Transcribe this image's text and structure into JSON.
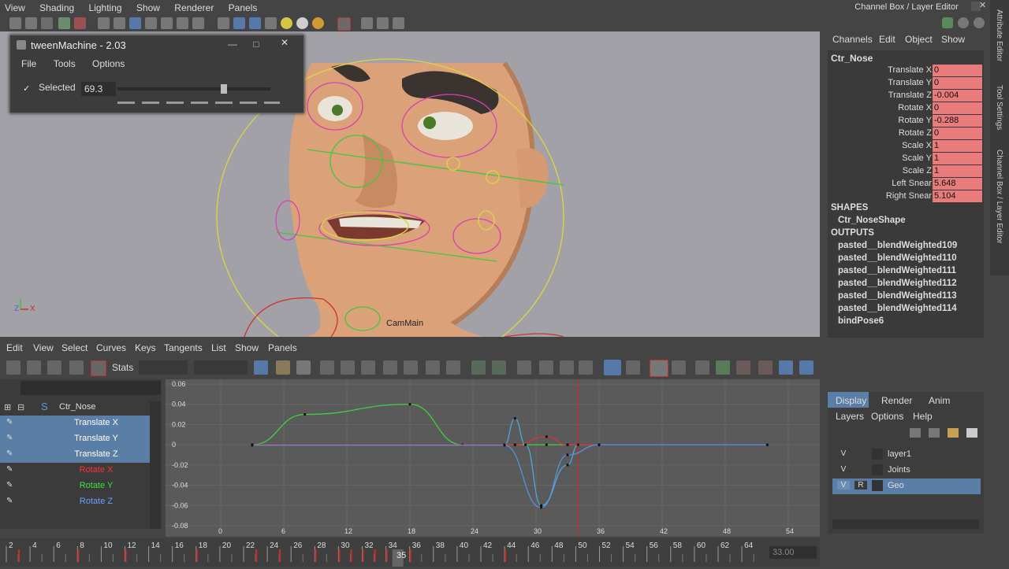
{
  "menubar": [
    "View",
    "Shading",
    "Lighting",
    "Show",
    "Renderer",
    "Panels"
  ],
  "viewport": {
    "camera_label": "CamMain",
    "axis_x": "X",
    "axis_z": "Z"
  },
  "tween": {
    "title": "tweenMachine - 2.03",
    "menu": [
      "File",
      "Tools",
      "Options"
    ],
    "selected_label": "Selected",
    "value": "69.3",
    "slider_fraction": 0.69
  },
  "channelbox": {
    "title": "Channel Box / Layer Editor",
    "menu": [
      "Channels",
      "Edit",
      "Object",
      "Show"
    ],
    "node": "Ctr_Nose",
    "channels": [
      {
        "name": "Translate X",
        "value": "0"
      },
      {
        "name": "Translate Y",
        "value": "0"
      },
      {
        "name": "Translate Z",
        "value": "-0.004"
      },
      {
        "name": "Rotate X",
        "value": "0"
      },
      {
        "name": "Rotate Y",
        "value": "-0.288"
      },
      {
        "name": "Rotate Z",
        "value": "0"
      },
      {
        "name": "Scale X",
        "value": "1"
      },
      {
        "name": "Scale Y",
        "value": "1"
      },
      {
        "name": "Scale Z",
        "value": "1"
      },
      {
        "name": "Left Snear",
        "value": "5.648"
      },
      {
        "name": "Right Snear",
        "value": "5.104"
      }
    ],
    "shapes_header": "SHAPES",
    "shape": "Ctr_NoseShape",
    "outputs_header": "OUTPUTS",
    "outputs": [
      "pasted__blendWeighted109",
      "pasted__blendWeighted110",
      "pasted__blendWeighted111",
      "pasted__blendWeighted112",
      "pasted__blendWeighted113",
      "pasted__blendWeighted114",
      "bindPose6"
    ]
  },
  "side_tabs": [
    "Attribute Editor",
    "Tool Settings",
    "Channel Box / Layer Editor"
  ],
  "layer_editor": {
    "tabs": [
      "Display",
      "Render",
      "Anim"
    ],
    "menu": [
      "Layers",
      "Options",
      "Help"
    ],
    "layers": [
      {
        "v": "V",
        "r": "",
        "name": "layer1",
        "selected": false
      },
      {
        "v": "V",
        "r": "",
        "name": "Joints",
        "selected": false
      },
      {
        "v": "V",
        "r": "R",
        "name": "Geo",
        "selected": true
      }
    ]
  },
  "graph_editor": {
    "menu": [
      "Edit",
      "View",
      "Select",
      "Curves",
      "Keys",
      "Tangents",
      "List",
      "Show",
      "Panels"
    ],
    "stats_label": "Stats",
    "outliner": {
      "node": "Ctr_Nose",
      "curves": [
        {
          "name": "Translate X",
          "color": "#ffffff",
          "selected": true
        },
        {
          "name": "Translate Y",
          "color": "#ffffff",
          "selected": true
        },
        {
          "name": "Translate Z",
          "color": "#ffffff",
          "selected": true
        },
        {
          "name": "Rotate X",
          "color": "#ff3030",
          "selected": false
        },
        {
          "name": "Rotate Y",
          "color": "#40e040",
          "selected": false
        },
        {
          "name": "Rotate Z",
          "color": "#6aa0ff",
          "selected": false
        }
      ]
    },
    "y_ticks": [
      "0.06",
      "0.04",
      "0.02",
      "0",
      "-0.02",
      "-0.04",
      "-0.06",
      "-0.08"
    ],
    "x_ticks": [
      "0",
      "6",
      "12",
      "18",
      "24",
      "30",
      "36",
      "42",
      "48",
      "54"
    ],
    "current_frame": 34
  },
  "chart_data": {
    "type": "line",
    "ylim": [
      -0.08,
      0.06
    ],
    "xlim": [
      -4,
      56
    ],
    "series": [
      {
        "color": "#3fd23f",
        "x": [
          3,
          8,
          18,
          23,
          28,
          31,
          33,
          36
        ],
        "y": [
          0,
          0.03,
          0.04,
          0,
          0,
          0,
          0,
          0
        ]
      },
      {
        "color": "#e23030",
        "x": [
          3,
          28,
          31,
          33,
          36
        ],
        "y": [
          0,
          0,
          0.008,
          0,
          0
        ]
      },
      {
        "color": "#5a8fe0",
        "x": [
          3,
          27,
          30.5,
          33,
          36,
          52
        ],
        "y": [
          -0.0005,
          -0.0005,
          -0.062,
          -0.01,
          0,
          0
        ]
      },
      {
        "color": "#4fa6d8",
        "x": [
          27,
          28,
          29,
          30.5,
          33,
          34
        ],
        "y": [
          0,
          0.026,
          0,
          -0.06,
          -0.02,
          0
        ]
      }
    ]
  },
  "timeline": {
    "ticks": [
      "2",
      "4",
      "6",
      "8",
      "10",
      "12",
      "14",
      "16",
      "18",
      "20",
      "22",
      "24",
      "26",
      "28",
      "30",
      "32",
      "34",
      "36",
      "38",
      "40",
      "42",
      "44",
      "46",
      "48",
      "50",
      "52",
      "54",
      "56",
      "58",
      "60",
      "62",
      "64"
    ],
    "current_frame": "35",
    "end_field": "33.00"
  }
}
